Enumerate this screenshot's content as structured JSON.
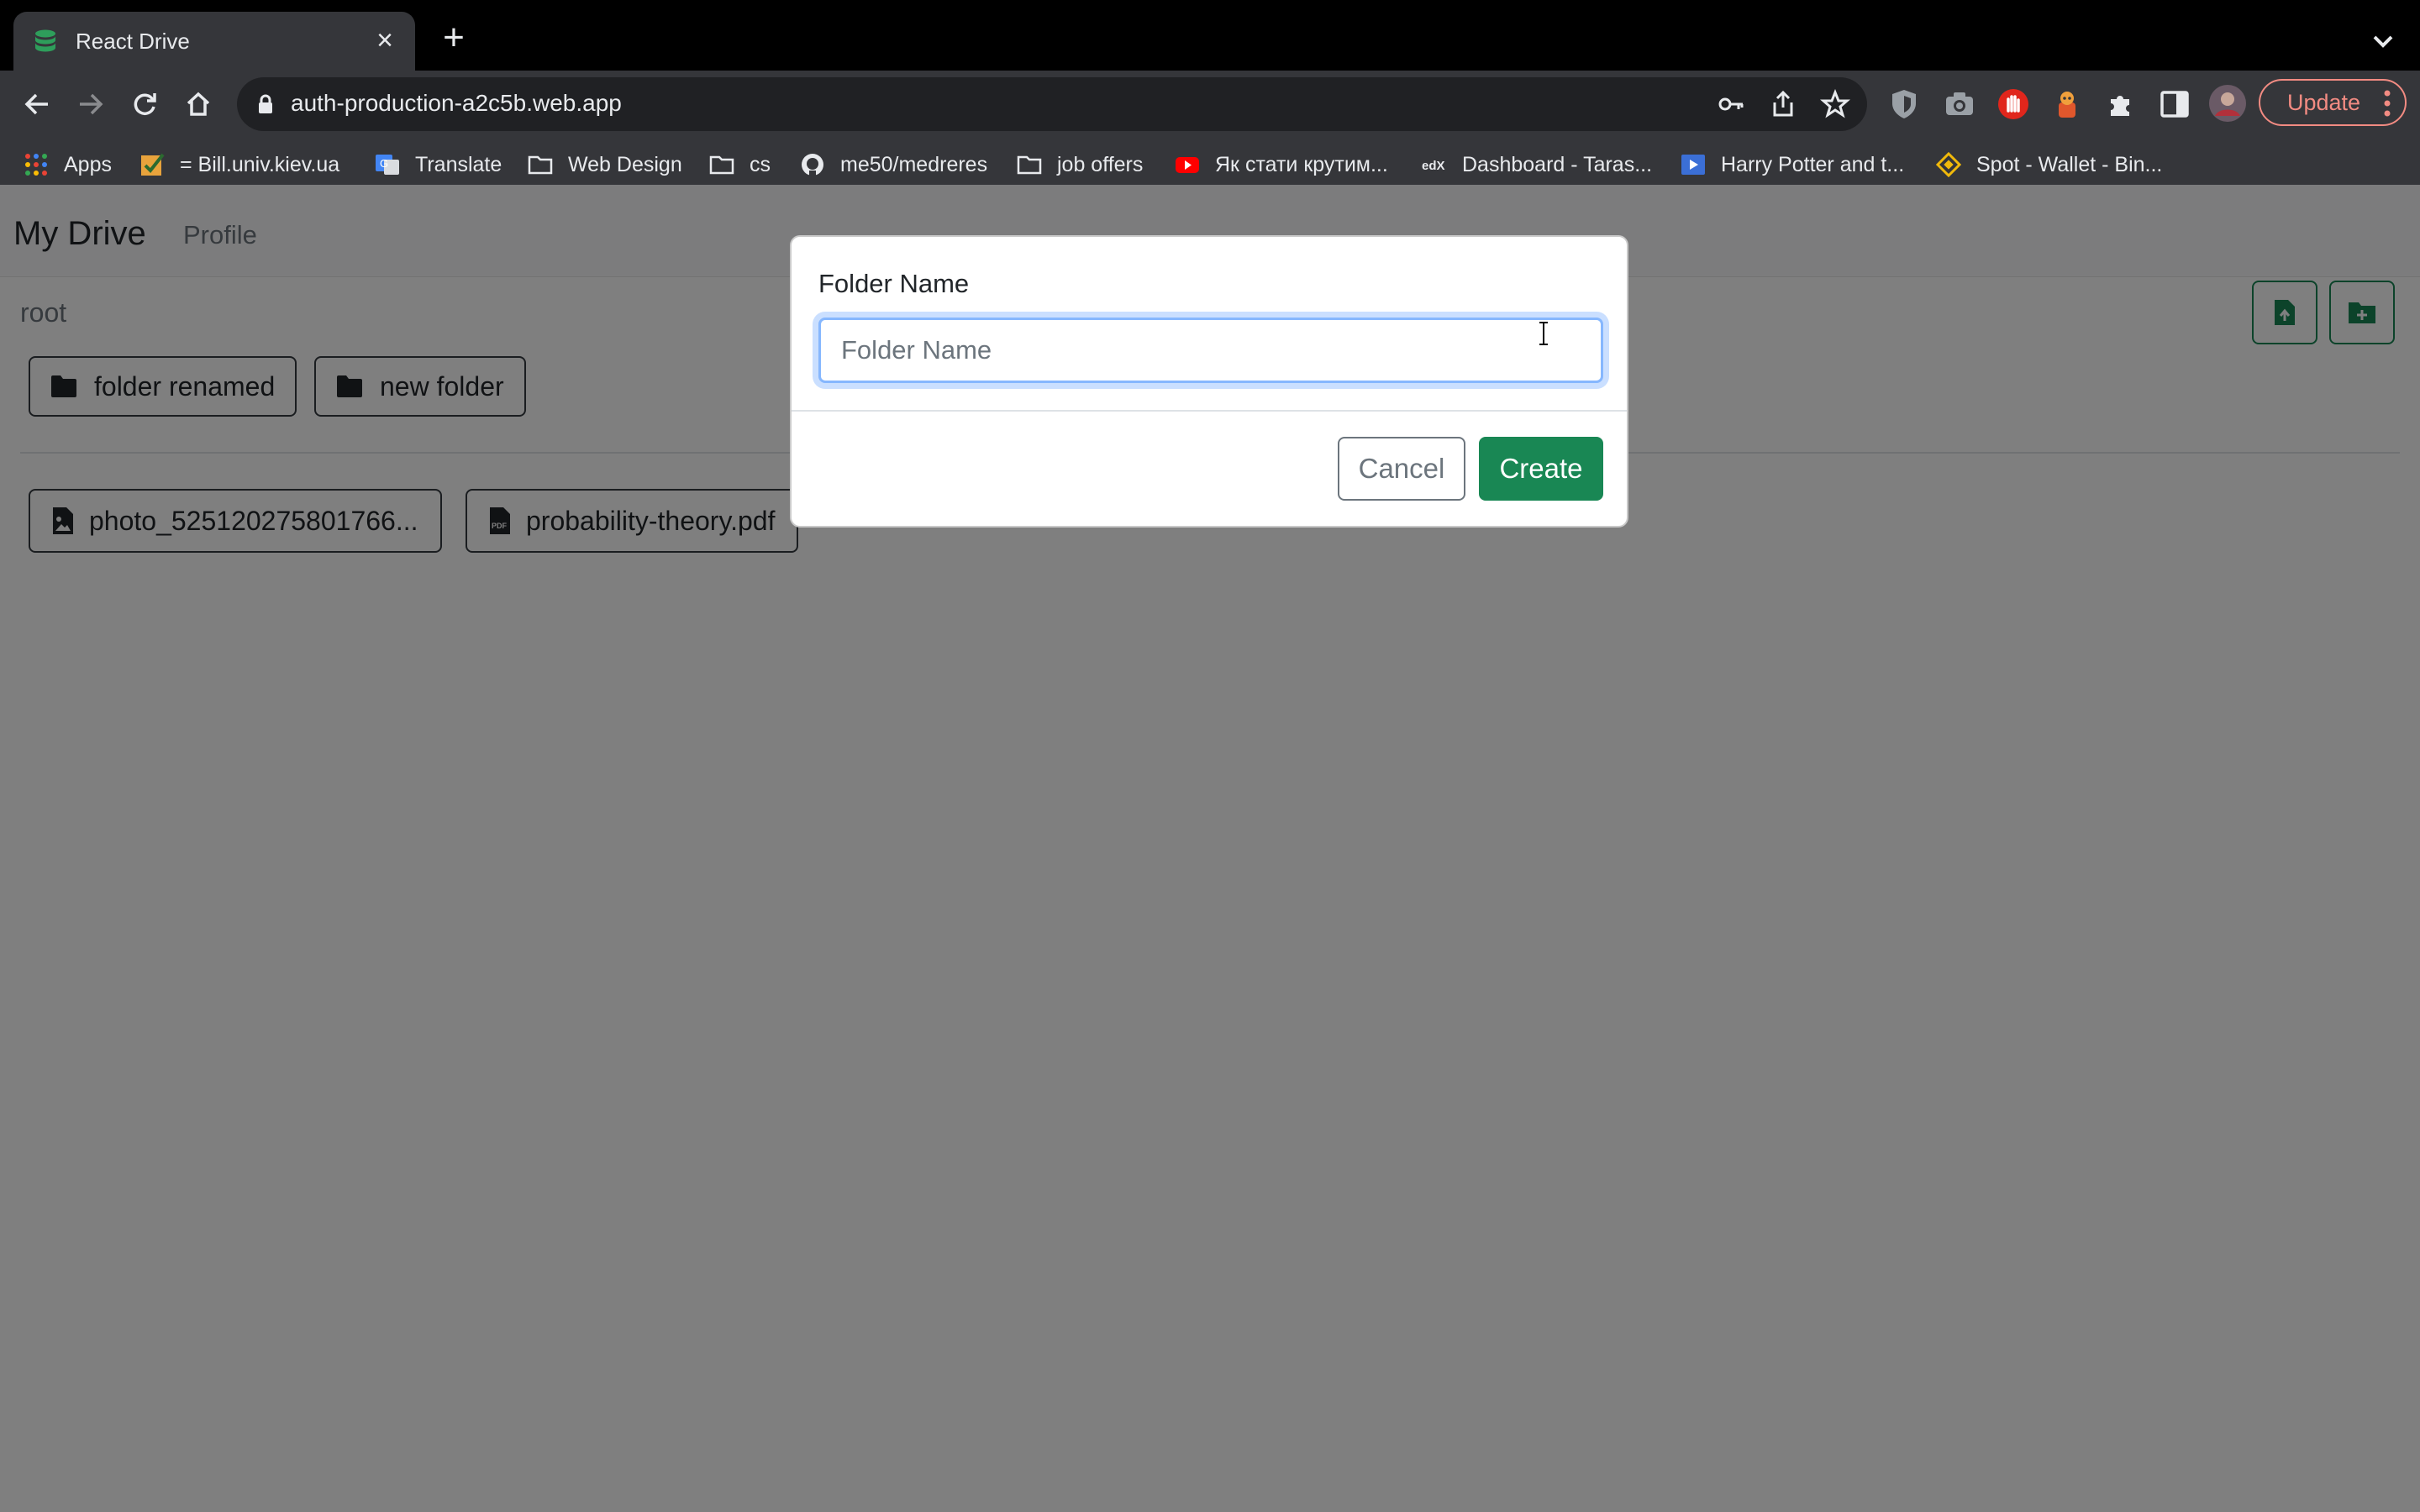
{
  "browser": {
    "tab": {
      "title": "React Drive",
      "favicon": "database-icon"
    },
    "address_bar": {
      "url": "auth-production-a2c5b.web.app"
    },
    "update_label": "Update",
    "bookmarks": [
      {
        "label": "Apps",
        "icon": "apps-grid-icon"
      },
      {
        "label": "= Bill.univ.kiev.ua",
        "icon": "checkbox-icon"
      },
      {
        "label": "Translate",
        "icon": "google-translate-icon"
      },
      {
        "label": "Web Design",
        "icon": "folder-icon"
      },
      {
        "label": "cs",
        "icon": "folder-icon"
      },
      {
        "label": "me50/medreres",
        "icon": "github-icon"
      },
      {
        "label": "job offers",
        "icon": "folder-icon"
      },
      {
        "label": "Як стати крутим...",
        "icon": "youtube-icon"
      },
      {
        "label": "Dashboard - Taras...",
        "icon": "edx-icon"
      },
      {
        "label": "Harry Potter and t...",
        "icon": "video-icon"
      },
      {
        "label": "Spot - Wallet - Bin...",
        "icon": "binance-icon"
      }
    ]
  },
  "app": {
    "brand": "My Drive",
    "nav_profile": "Profile",
    "breadcrumb": "root",
    "folders": [
      {
        "name": "folder renamed"
      },
      {
        "name": "new folder"
      }
    ],
    "files": [
      {
        "name": "photo_525120275801766...",
        "type": "image"
      },
      {
        "name": "probability-theory.pdf",
        "type": "pdf"
      }
    ]
  },
  "modal": {
    "label": "Folder Name",
    "input_value": "",
    "input_placeholder": "Folder Name",
    "cancel_label": "Cancel",
    "create_label": "Create"
  },
  "colors": {
    "primary_green": "#198754",
    "focus_blue": "#86b7fe",
    "chrome_dark": "#35363a"
  }
}
